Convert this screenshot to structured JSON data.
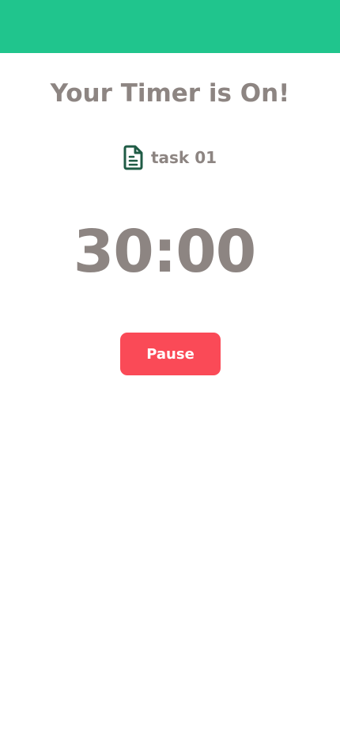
{
  "header": {
    "color": "#20c58d"
  },
  "main": {
    "title": "Your Timer is On!",
    "task": {
      "icon": "document-icon",
      "name": "task 01"
    },
    "timer": {
      "display": "30:00"
    },
    "pause_button": {
      "label": "Pause",
      "color": "#fa4a57"
    }
  },
  "colors": {
    "text": "#8d8582",
    "icon": "#1f5b45"
  }
}
